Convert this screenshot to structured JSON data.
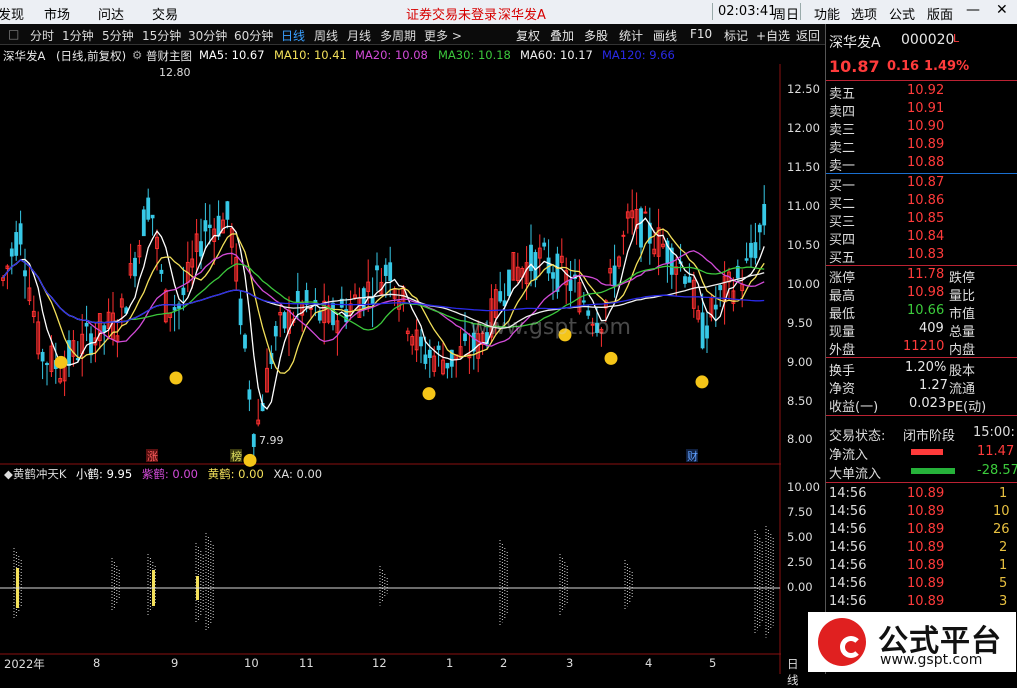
{
  "menu": {
    "items": [
      "发现",
      "市场",
      "问达",
      "交易"
    ],
    "alert": "证券交易未登录",
    "stock_link": "深华发A",
    "clock": "02:03:41",
    "weekday": "周日",
    "right_items": [
      "功能",
      "选项",
      "公式",
      "版面"
    ],
    "min_icon": "minimize-icon",
    "close_icon": "close-icon"
  },
  "periods": [
    "分时",
    "1分钟",
    "5分钟",
    "15分钟",
    "30分钟",
    "60分钟",
    "日线",
    "周线",
    "月线",
    "多周期",
    "更多 >"
  ],
  "tools": [
    "复权",
    "叠加",
    "多股",
    "统计",
    "画线",
    "F10",
    "标记",
    "+自选",
    "返回"
  ],
  "main_indicator": {
    "name": "深华发A",
    "mode": "(日线,前复权)",
    "formula": "普财主图",
    "ma5": "MA5: 10.67",
    "ma10": "MA10: 10.41",
    "ma20": "MA20: 10.08",
    "ma30": "MA30: 10.18",
    "ma60": "MA60: 10.17",
    "ma120": "MA120: 9.66",
    "high_label": "12.80",
    "low_label": "7.99",
    "colors": {
      "ma5": "#ffffff",
      "ma10": "#f3e05a",
      "ma20": "#d24bd8",
      "ma30": "#3cc83c",
      "ma60": "#f0f0f0",
      "ma120": "#2a2ae8",
      "up": "#ff3030",
      "down": "#37c8e6"
    }
  },
  "markers": {
    "zhang": "涨",
    "bang": "榜",
    "cai": "财"
  },
  "price_axis": [
    "12.50",
    "12.00",
    "11.50",
    "11.00",
    "10.50",
    "10.00",
    "9.50",
    "9.00",
    "8.50",
    "8.00"
  ],
  "sub_indicator": {
    "name": "◆黄鹤冲天K",
    "xiaohe": "小鹤: 9.95",
    "zihe": "紫鹤: 0.00",
    "huanghe": "黄鹤: 0.00",
    "xa": "XA: 0.00"
  },
  "sub_axis": [
    "10.00",
    "7.50",
    "5.00",
    "2.50",
    "0.00"
  ],
  "time_axis": [
    "2022年",
    "8",
    "9",
    "10",
    "11",
    "12",
    "1",
    "2",
    "3",
    "4",
    "5"
  ],
  "time_axis_right": "日线",
  "watermark": "www.gspt.com",
  "chart_data": {
    "type": "candlestick",
    "ylim": [
      7.8,
      12.8
    ],
    "high": 12.8,
    "low": 7.99
  },
  "quote": {
    "name": "深华发A",
    "code": "000020",
    "flag": "L",
    "price": "10.87",
    "change": "0.16",
    "pct": "1.49%",
    "asks": [
      {
        "label": "卖五",
        "price": "10.92"
      },
      {
        "label": "卖四",
        "price": "10.91"
      },
      {
        "label": "卖三",
        "price": "10.90"
      },
      {
        "label": "卖二",
        "price": "10.89"
      },
      {
        "label": "卖一",
        "price": "10.88"
      }
    ],
    "bids": [
      {
        "label": "买一",
        "price": "10.87"
      },
      {
        "label": "买二",
        "price": "10.86"
      },
      {
        "label": "买三",
        "price": "10.85"
      },
      {
        "label": "买四",
        "price": "10.84"
      },
      {
        "label": "买五",
        "price": "10.83"
      }
    ],
    "stats": [
      {
        "l1": "涨停",
        "v1": "11.78",
        "l2": "跌停"
      },
      {
        "l1": "最高",
        "v1": "10.98",
        "l2": "量比"
      },
      {
        "l1": "最低",
        "v1": "10.66",
        "l2": "市值"
      },
      {
        "l1": "现量",
        "v1": "409",
        "l2": "总量"
      },
      {
        "l1": "外盘",
        "v1": "11210",
        "l2": "内盘"
      }
    ],
    "stats2": [
      {
        "l1": "换手",
        "v1": "1.20%",
        "l2": "股本"
      },
      {
        "l1": "净资",
        "v1": "1.27",
        "l2": "流通"
      },
      {
        "l1": "收益(一)",
        "v1": "0.023",
        "l2": "PE(动)"
      }
    ],
    "trade_state_label": "交易状态:",
    "trade_state": "闭市阶段",
    "trade_time": "15:00:",
    "net_inflow_label": "净流入",
    "net_inflow": "11.47",
    "big_inflow_label": "大单流入",
    "big_inflow": "-28.57",
    "ticks": [
      {
        "time": "14:56",
        "price": "10.89",
        "vol": "1"
      },
      {
        "time": "14:56",
        "price": "10.89",
        "vol": "10"
      },
      {
        "time": "14:56",
        "price": "10.89",
        "vol": "26"
      },
      {
        "time": "14:56",
        "price": "10.89",
        "vol": "2"
      },
      {
        "time": "14:56",
        "price": "10.89",
        "vol": "1"
      },
      {
        "time": "14:56",
        "price": "10.89",
        "vol": "5"
      },
      {
        "time": "14:56",
        "price": "10.89",
        "vol": "3"
      }
    ]
  },
  "logo": {
    "name": "公式平台",
    "url": "www.gspt.com"
  }
}
